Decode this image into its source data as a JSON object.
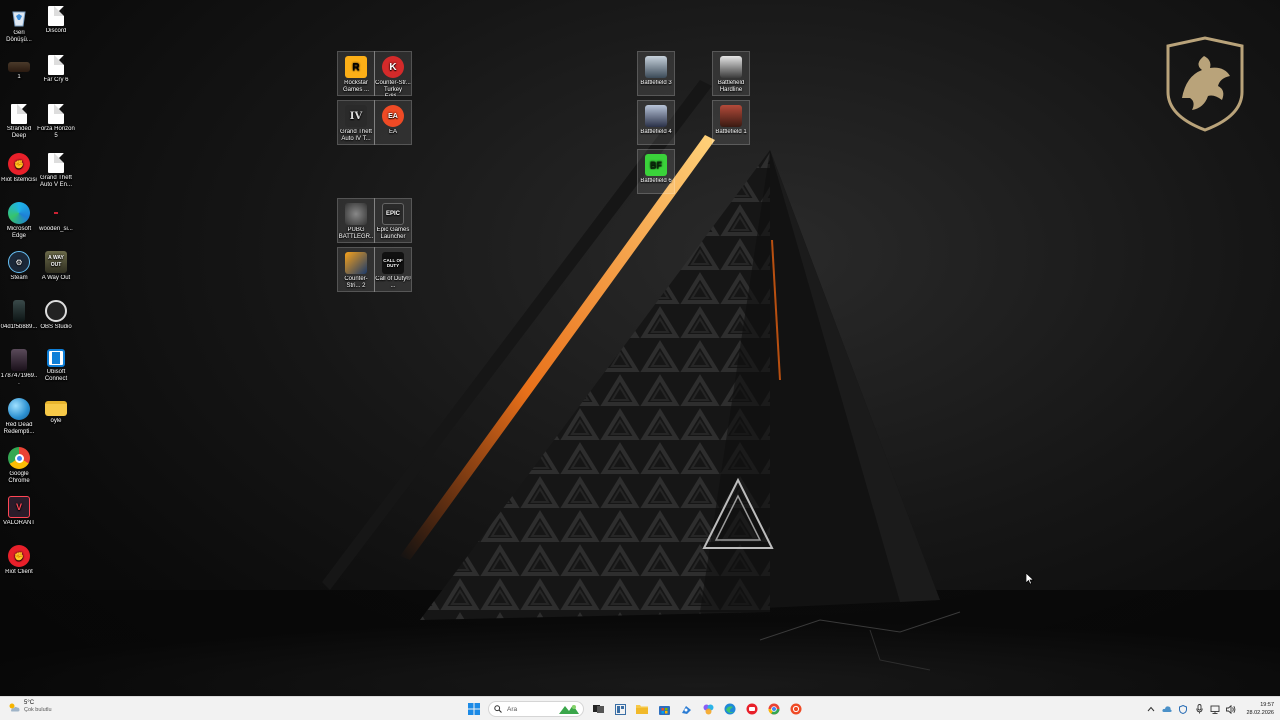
{
  "desktop": {
    "left_column": [
      {
        "id": "recycle-bin",
        "label": "Geri Dönüşü...",
        "icon": "recycle-bin-icon"
      },
      {
        "id": "discord",
        "label": "Discord",
        "icon": "file-icon"
      },
      {
        "id": "shortcut-1",
        "label": "1",
        "icon": "image-thumbnail-icon"
      },
      {
        "id": "far-cry-6",
        "label": "Far Cry 6",
        "icon": "file-icon"
      },
      {
        "id": "stranded-deep",
        "label": "Stranded Deep",
        "icon": "file-icon"
      },
      {
        "id": "forza-horizon-5",
        "label": "Forza Horizon 5",
        "icon": "file-icon"
      },
      {
        "id": "riot-istemcisi",
        "label": "Riot İstemcisi",
        "icon": "riot-icon"
      },
      {
        "id": "gta-v-enhanced",
        "label": "Grand Theft Auto V En...",
        "icon": "file-icon"
      },
      {
        "id": "microsoft-edge",
        "label": "Microsoft Edge",
        "icon": "edge-icon"
      },
      {
        "id": "wooden",
        "label": "wooden_si...",
        "icon": "image-thumbnail-icon"
      },
      {
        "id": "steam",
        "label": "Steam",
        "icon": "steam-icon"
      },
      {
        "id": "a-way-out",
        "label": "A Way Out",
        "icon": "a-way-out-icon"
      },
      {
        "id": "image-04d",
        "label": "04d1f5b889...",
        "icon": "image-thumbnail-icon"
      },
      {
        "id": "obs-studio",
        "label": "OBS Studio",
        "icon": "obs-icon"
      },
      {
        "id": "image-178",
        "label": "1787471969...",
        "icon": "image-thumbnail-icon"
      },
      {
        "id": "ubisoft-connect",
        "label": "Ubisoft Connect",
        "icon": "ubisoft-icon"
      },
      {
        "id": "red-dead",
        "label": "Red Dead Redempti...",
        "icon": "globe-icon"
      },
      {
        "id": "oyle-folder",
        "label": "öyle",
        "icon": "folder-icon"
      },
      {
        "id": "google-chrome",
        "label": "Google Chrome",
        "icon": "chrome-icon"
      },
      {
        "id": "valorant",
        "label": "VALORANT",
        "icon": "valorant-icon"
      },
      {
        "id": "riot-client",
        "label": "Riot Client",
        "icon": "riot-icon"
      }
    ],
    "group_left": [
      {
        "id": "rockstar",
        "label": "Rockstar Games ...",
        "icon": "rockstar-icon",
        "glyph": "R"
      },
      {
        "id": "counter-strike-turkey",
        "label": "Counter-Str... Turkey Editi...",
        "icon": "counter-strike-turkey-icon",
        "glyph": "K"
      },
      {
        "id": "gta-iv",
        "label": "Grand Theft Auto IV T...",
        "icon": "gta-iv-icon",
        "glyph": "IV"
      },
      {
        "id": "ea",
        "label": "EA",
        "icon": "ea-icon",
        "glyph": "EA"
      },
      {
        "id": "pubg",
        "label": "PUBG BATTLEGR...",
        "icon": "pubg-icon",
        "glyph": ""
      },
      {
        "id": "epic-games",
        "label": "Epic Games Launcher",
        "icon": "epic-games-icon",
        "glyph": "EPIC"
      },
      {
        "id": "counter-strike-2",
        "label": "Counter-Stri... 2",
        "icon": "counter-strike-2-icon",
        "glyph": ""
      },
      {
        "id": "call-of-duty",
        "label": "Call of Duty® ...",
        "icon": "call-of-duty-icon",
        "glyph": "CALL OF DUTY"
      }
    ],
    "group_right": [
      {
        "id": "battlefield-3",
        "label": "Battlefield 3",
        "icon": "battlefield-3-icon"
      },
      {
        "id": "battlefield-hardline",
        "label": "Battlefield Hardline",
        "icon": "battlefield-hardline-icon"
      },
      {
        "id": "battlefield-4",
        "label": "Battlefield 4",
        "icon": "battlefield-4-icon"
      },
      {
        "id": "battlefield-1",
        "label": "Battlefield 1",
        "icon": "battlefield-1-icon"
      },
      {
        "id": "battlefield-6",
        "label": "Battlefield 6",
        "icon": "battlefield-6-icon",
        "glyph": "BF"
      }
    ]
  },
  "taskbar": {
    "weather": {
      "temp": "5°C",
      "condition": "Çok bulutlu",
      "icon": "partly-cloudy-icon"
    },
    "start_icon": "windows-start-icon",
    "search": {
      "placeholder": "Ara",
      "icon": "search-icon"
    },
    "pinned": [
      {
        "id": "task-view",
        "icon": "task-view-icon"
      },
      {
        "id": "widgets",
        "icon": "widgets-icon"
      },
      {
        "id": "file-explorer",
        "icon": "folder-icon"
      },
      {
        "id": "store",
        "icon": "microsoft-store-icon"
      },
      {
        "id": "app-blue",
        "icon": "blue-app-icon"
      },
      {
        "id": "app-colorful",
        "icon": "colorful-app-icon"
      },
      {
        "id": "edge",
        "icon": "edge-icon"
      },
      {
        "id": "riot",
        "icon": "riot-icon"
      },
      {
        "id": "chrome",
        "icon": "chrome-icon"
      },
      {
        "id": "ea-app",
        "icon": "ea-icon"
      }
    ],
    "tray": [
      {
        "id": "chevron",
        "icon": "chevron-up-icon"
      },
      {
        "id": "onedrive",
        "icon": "cloud-icon"
      },
      {
        "id": "security",
        "icon": "shield-icon"
      },
      {
        "id": "mic",
        "icon": "microphone-icon"
      },
      {
        "id": "network",
        "icon": "network-icon"
      },
      {
        "id": "volume",
        "icon": "speaker-icon"
      }
    ],
    "clock": {
      "time": "19:57",
      "date": "28.02.2026"
    }
  },
  "colors": {
    "taskbar_bg": "#f2f2f2",
    "desktop_dark": "#111111",
    "accent_orange": "#ff7a1a",
    "msi_gold": "#b9a37a"
  }
}
